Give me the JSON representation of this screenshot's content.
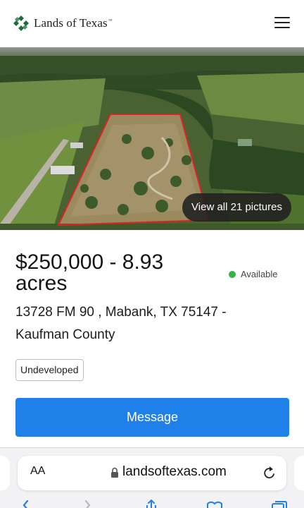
{
  "header": {
    "brand": "Lands of Texas",
    "brand_tm": "™",
    "brand_color": "#1f6b3a"
  },
  "gallery": {
    "view_all_label": "View all 21 pictures"
  },
  "listing": {
    "price_title": "$250,000 - 8.93 acres",
    "status": "Available",
    "status_color": "#32b44a",
    "address": "13728 FM 90 , Mabank, TX 75147 - Kaufman County",
    "tag": "Undeveloped",
    "message_label": "Message",
    "accent_color": "#2080e9"
  },
  "browser": {
    "text_size_label": "AA",
    "url": "landsoftexas.com",
    "icons": [
      "lock-icon",
      "reload-icon",
      "back-icon",
      "forward-icon",
      "share-icon",
      "bookmarks-icon",
      "tabs-icon"
    ]
  }
}
